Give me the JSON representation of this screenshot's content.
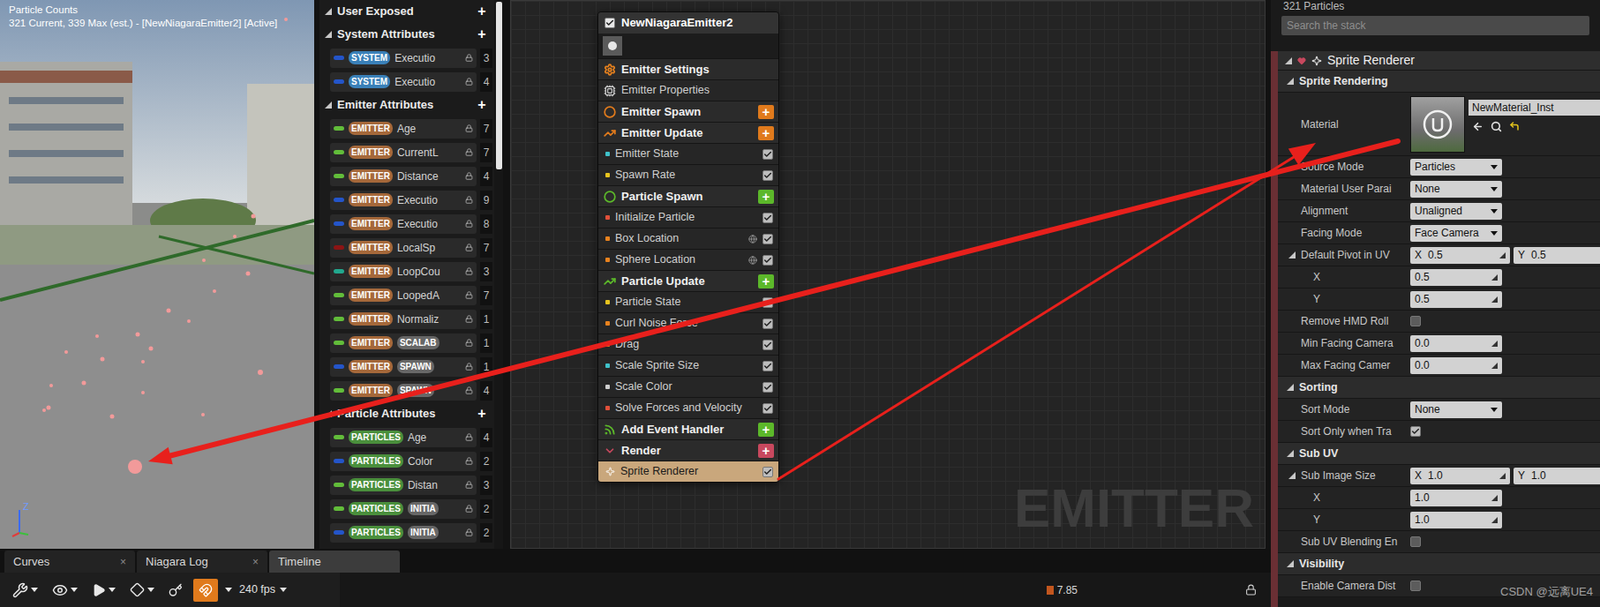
{
  "viewport": {
    "title": "Particle Counts",
    "stats": "321 Current, 339 Max (est.) - [NewNiagaraEmitter2] [Active]",
    "axis": "Z"
  },
  "parameters": [
    {
      "label": "User Exposed",
      "add": "+",
      "expanded": true,
      "items": []
    },
    {
      "label": "System Attributes",
      "add": "+",
      "expanded": true,
      "items": [
        {
          "type_color": "#2455c9",
          "tags": [
            {
              "label": "SYSTEM",
              "color": "#3a80b8"
            }
          ],
          "name": "Executio",
          "count": "3"
        },
        {
          "type_color": "#2455c9",
          "tags": [
            {
              "label": "SYSTEM",
              "color": "#3a80b8"
            }
          ],
          "name": "Executio",
          "count": "4"
        }
      ]
    },
    {
      "label": "Emitter Attributes",
      "add": "+",
      "expanded": true,
      "items": [
        {
          "type_color": "#62bd3a",
          "tags": [
            {
              "label": "EMITTER",
              "color": "#a5683a"
            }
          ],
          "name": "Age",
          "count": "7"
        },
        {
          "type_color": "#62bd3a",
          "tags": [
            {
              "label": "EMITTER",
              "color": "#a5683a"
            }
          ],
          "name": "CurrentL",
          "count": "7"
        },
        {
          "type_color": "#62bd3a",
          "tags": [
            {
              "label": "EMITTER",
              "color": "#a5683a"
            }
          ],
          "name": "Distance",
          "count": "4"
        },
        {
          "type_color": "#2455c9",
          "tags": [
            {
              "label": "EMITTER",
              "color": "#a5683a"
            }
          ],
          "name": "Executio",
          "count": "9"
        },
        {
          "type_color": "#2455c9",
          "tags": [
            {
              "label": "EMITTER",
              "color": "#a5683a"
            }
          ],
          "name": "Executio",
          "count": "8"
        },
        {
          "type_color": "#8c1414",
          "tags": [
            {
              "label": "EMITTER",
              "color": "#a5683a"
            }
          ],
          "name": "LocalSp",
          "count": "7"
        },
        {
          "type_color": "#22a88e",
          "tags": [
            {
              "label": "EMITTER",
              "color": "#a5683a"
            }
          ],
          "name": "LoopCou",
          "count": "3"
        },
        {
          "type_color": "#62bd3a",
          "tags": [
            {
              "label": "EMITTER",
              "color": "#a5683a"
            }
          ],
          "name": "LoopedA",
          "count": "7"
        },
        {
          "type_color": "#62bd3a",
          "tags": [
            {
              "label": "EMITTER",
              "color": "#a5683a"
            }
          ],
          "name": "Normaliz",
          "count": "1"
        },
        {
          "type_color": "#62bd3a",
          "tags": [
            {
              "label": "EMITTER",
              "color": "#a5683a"
            },
            {
              "label": "SCALAB",
              "color": "#676767"
            }
          ],
          "name": "",
          "count": "1"
        },
        {
          "type_color": "#2455c9",
          "tags": [
            {
              "label": "EMITTER",
              "color": "#a5683a"
            },
            {
              "label": "SPAWN",
              "color": "#676767"
            }
          ],
          "name": "",
          "count": "1"
        },
        {
          "type_color": "#62bd3a",
          "tags": [
            {
              "label": "EMITTER",
              "color": "#a5683a"
            },
            {
              "label": "SPAWN",
              "color": "#676767"
            }
          ],
          "name": "",
          "count": "4"
        }
      ]
    },
    {
      "label": "Particle Attributes",
      "add": "+",
      "expanded": true,
      "items": [
        {
          "type_color": "#62bd3a",
          "tags": [
            {
              "label": "PARTICLES",
              "color": "#4a8f3c"
            }
          ],
          "name": "Age",
          "count": "4"
        },
        {
          "type_color": "#2455c9",
          "tags": [
            {
              "label": "PARTICLES",
              "color": "#4a8f3c"
            }
          ],
          "name": "Color",
          "count": "2"
        },
        {
          "type_color": "#62bd3a",
          "tags": [
            {
              "label": "PARTICLES",
              "color": "#4a8f3c"
            }
          ],
          "name": "Distan",
          "count": "3"
        },
        {
          "type_color": "#62bd3a",
          "tags": [
            {
              "label": "PARTICLES",
              "color": "#4a8f3c"
            },
            {
              "label": "INITIA",
              "color": "#676767"
            }
          ],
          "name": "",
          "count": "2"
        },
        {
          "type_color": "#2455c9",
          "tags": [
            {
              "label": "PARTICLES",
              "color": "#4a8f3c"
            },
            {
              "label": "INITIA",
              "color": "#676767"
            }
          ],
          "name": "",
          "count": "2"
        }
      ]
    }
  ],
  "node": {
    "title": "NewNiagaraEmitter2",
    "enabled": true,
    "rows": [
      {
        "kind": "settings",
        "label": "Emitter Settings",
        "color": "#e8821e"
      },
      {
        "kind": "properties",
        "label": "Emitter Properties",
        "color": "#d0d0d0"
      },
      {
        "kind": "spawn",
        "label": "Emitter Spawn",
        "color": "#e07a1c",
        "add": "+"
      },
      {
        "kind": "update",
        "label": "Emitter Update",
        "color": "#e07a1c",
        "add": "+"
      },
      {
        "kind": "module",
        "label": "Emitter State",
        "color": "#3fc1c9",
        "checked": true,
        "linked": false,
        "selected": false
      },
      {
        "kind": "module",
        "label": "Spawn Rate",
        "color": "#e8c41e",
        "checked": true,
        "linked": false,
        "selected": false
      },
      {
        "kind": "spawn",
        "label": "Particle Spawn",
        "color": "#5cb82a",
        "add": "+"
      },
      {
        "kind": "module",
        "label": "Initialize Particle",
        "color": "#e0503a",
        "checked": true,
        "linked": false,
        "selected": false
      },
      {
        "kind": "module",
        "label": "Box Location",
        "color": "#e8821e",
        "checked": true,
        "linked": true,
        "selected": false
      },
      {
        "kind": "module",
        "label": "Sphere Location",
        "color": "#e8821e",
        "checked": true,
        "linked": true,
        "selected": false
      },
      {
        "kind": "update",
        "label": "Particle Update",
        "color": "#5cb82a",
        "add": "+"
      },
      {
        "kind": "module",
        "label": "Particle State",
        "color": "#e8c41e",
        "checked": true,
        "linked": false,
        "selected": false
      },
      {
        "kind": "module",
        "label": "Curl Noise Force",
        "color": "#e8821e",
        "checked": true,
        "linked": false,
        "selected": false
      },
      {
        "kind": "module",
        "label": "Drag",
        "color": "#e8821e",
        "checked": true,
        "linked": false,
        "selected": false
      },
      {
        "kind": "module",
        "label": "Scale Sprite Size",
        "color": "#3fc1c9",
        "checked": true,
        "linked": false,
        "selected": false
      },
      {
        "kind": "module",
        "label": "Scale Color",
        "color": "#cfcfcf",
        "checked": true,
        "linked": false,
        "selected": false
      },
      {
        "kind": "module",
        "label": "Solve Forces and Velocity",
        "color": "#e0503a",
        "checked": true,
        "linked": false,
        "selected": false
      },
      {
        "kind": "event",
        "label": "Add Event Handler",
        "color": "#5cb82a",
        "add": "+"
      },
      {
        "kind": "render",
        "label": "Render",
        "color": "#c8485e",
        "add": "+"
      },
      {
        "kind": "renderer",
        "label": "Sprite Renderer",
        "color": "#ffffff",
        "checked": true,
        "linked": false,
        "selected": true
      }
    ]
  },
  "graph": {
    "watermark": "EMITTER"
  },
  "details": {
    "count": "321 Particles",
    "search": {
      "placeholder": "Search the stack"
    },
    "header": {
      "label": "Sprite Renderer",
      "expanded": true
    },
    "rows": [
      {
        "kind": "category",
        "label": "Sprite Rendering",
        "expanded": true
      },
      {
        "kind": "material",
        "label": "Material",
        "value": "NewMaterial_Inst"
      },
      {
        "kind": "dropdown",
        "label": "Source Mode",
        "value": "Particles"
      },
      {
        "kind": "dropdown",
        "label": "Material User Parai",
        "value": "None"
      },
      {
        "kind": "dropdown",
        "label": "Alignment",
        "value": "Unaligned"
      },
      {
        "kind": "dropdown",
        "label": "Facing Mode",
        "value": "Face Camera"
      },
      {
        "kind": "vector",
        "label": "Default Pivot in UV",
        "expanded": true,
        "components": [
          {
            "axis": "X",
            "value": "0.5"
          },
          {
            "axis": "Y",
            "value": "0.5"
          }
        ],
        "children": [
          {
            "label": "X",
            "value": "0.5"
          },
          {
            "label": "Y",
            "value": "0.5"
          }
        ]
      },
      {
        "kind": "checkbox",
        "label": "Remove HMD Roll",
        "checked": false
      },
      {
        "kind": "number",
        "label": "Min Facing Camera",
        "value": "0.0"
      },
      {
        "kind": "number",
        "label": "Max Facing Camer",
        "value": "0.0"
      },
      {
        "kind": "category",
        "label": "Sorting",
        "expanded": true
      },
      {
        "kind": "dropdown",
        "label": "Sort Mode",
        "value": "None"
      },
      {
        "kind": "checkbox",
        "label": "Sort Only when Tra",
        "checked": true
      },
      {
        "kind": "category",
        "label": "Sub UV",
        "expanded": true
      },
      {
        "kind": "vector",
        "label": "Sub Image Size",
        "expanded": true,
        "components": [
          {
            "axis": "X",
            "value": "1.0"
          },
          {
            "axis": "Y",
            "value": "1.0"
          }
        ],
        "children": [
          {
            "label": "X",
            "value": "1.0"
          },
          {
            "label": "Y",
            "value": "1.0"
          }
        ]
      },
      {
        "kind": "checkbox",
        "label": "Sub UV Blending En",
        "checked": false
      },
      {
        "kind": "category",
        "label": "Visibility",
        "expanded": true
      },
      {
        "kind": "checkbox",
        "label": "Enable Camera Dist",
        "checked": false
      }
    ]
  },
  "bottom": {
    "close_glyph": "×",
    "tabs": [
      {
        "label": "Curves",
        "selected": false,
        "closable": true
      },
      {
        "label": "Niagara Log",
        "selected": false,
        "closable": true
      },
      {
        "label": "Timeline",
        "selected": true,
        "closable": false
      }
    ]
  },
  "toolbar": {
    "fps": "240 fps",
    "snapping": true,
    "time": "7.85"
  },
  "watermark": "CSDN @远离UE4"
}
